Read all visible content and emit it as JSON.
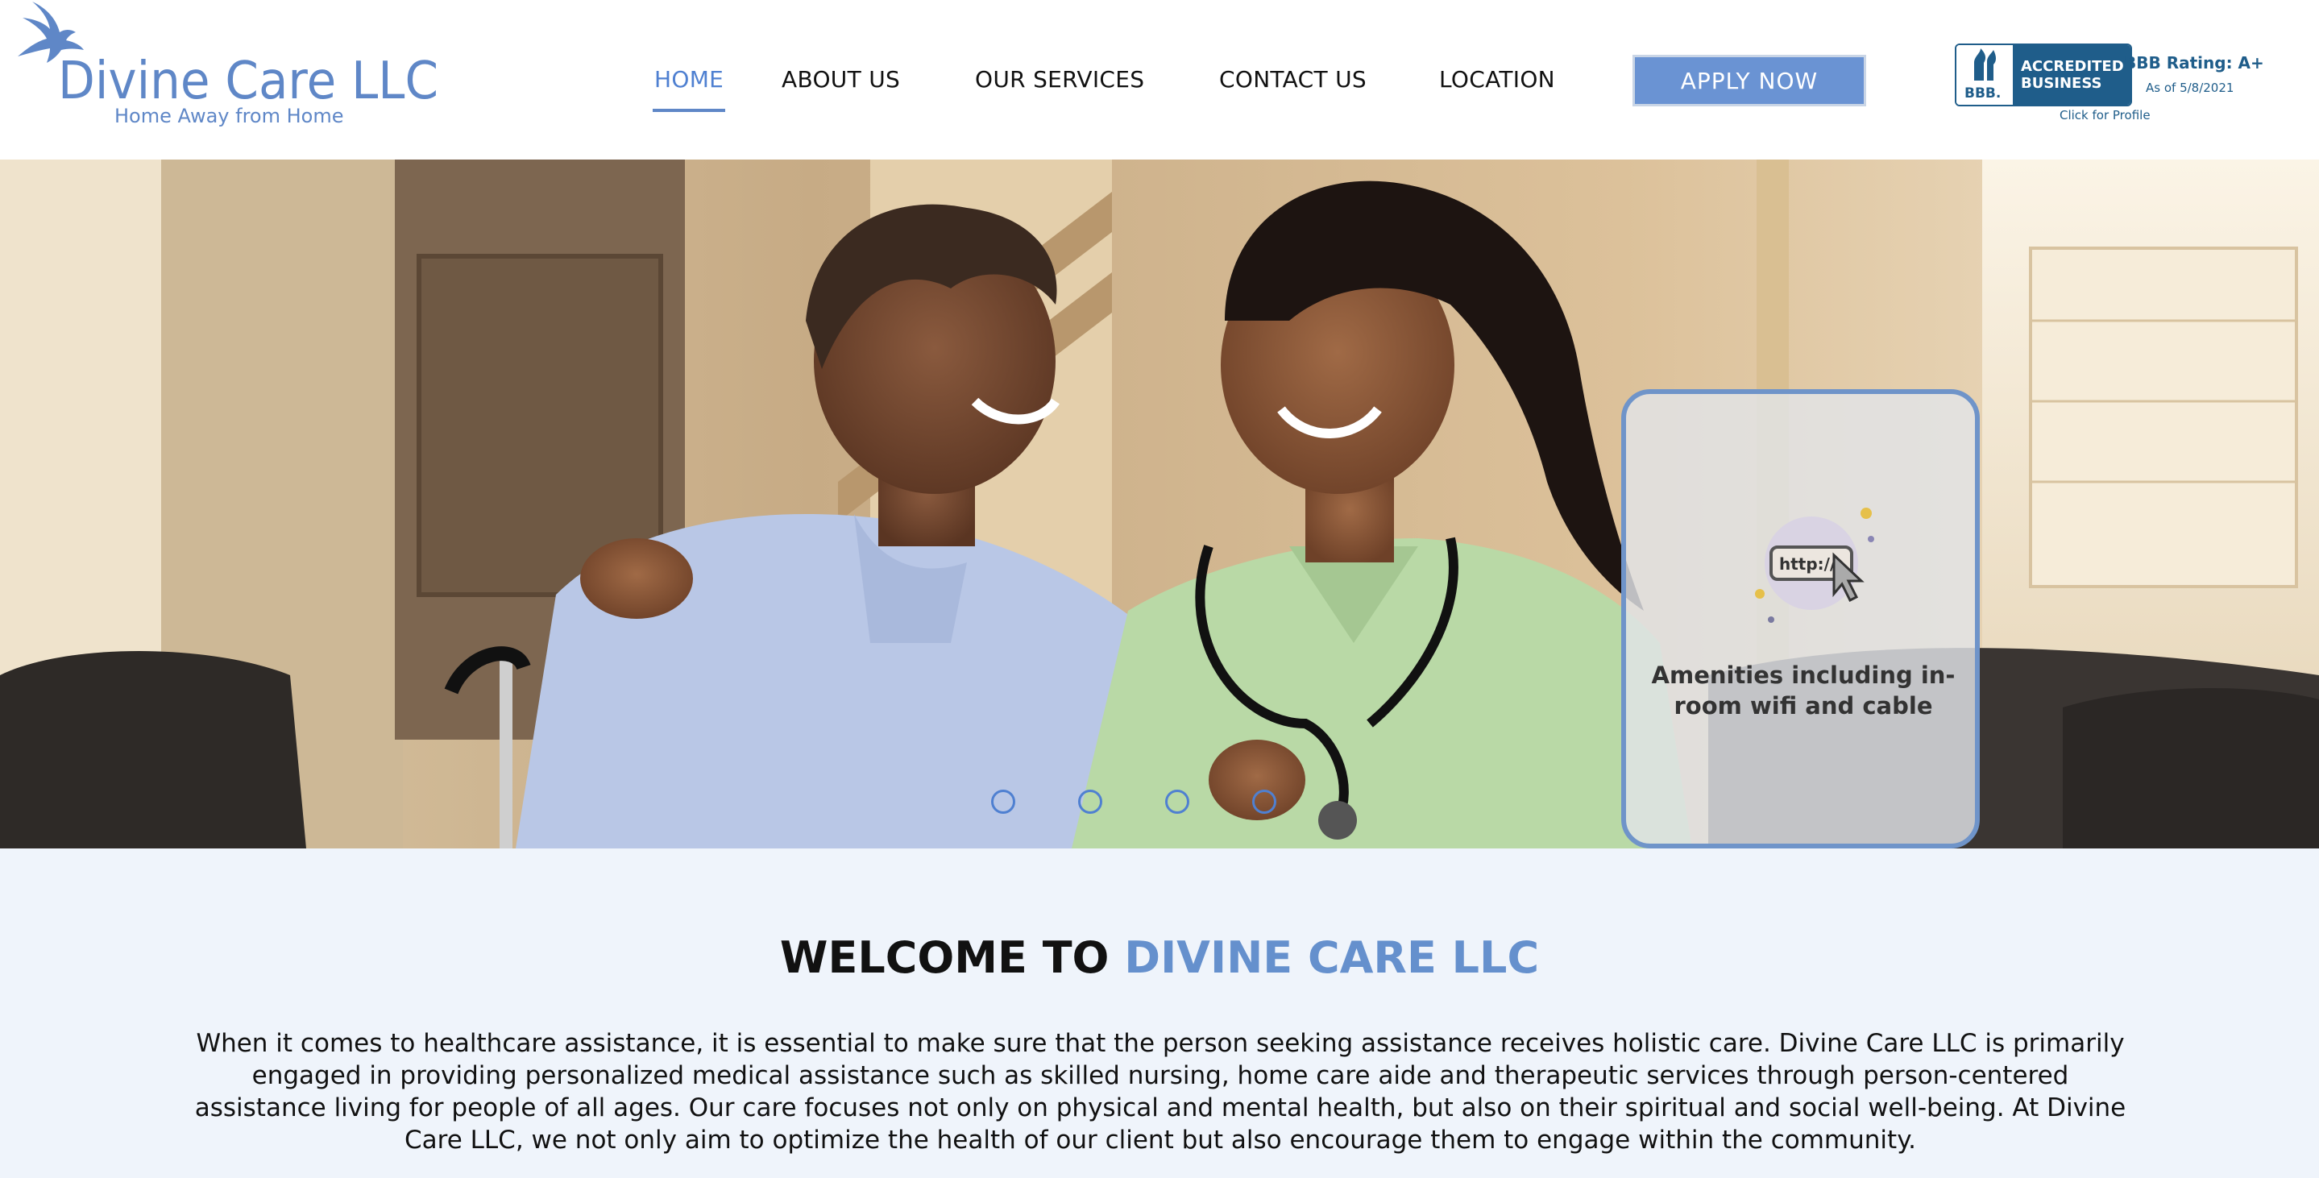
{
  "brand": {
    "name": "Divine Care LLC",
    "tagline": "Home Away from Home"
  },
  "nav": {
    "items": [
      {
        "label": "HOME",
        "active": true
      },
      {
        "label": "ABOUT US",
        "active": false
      },
      {
        "label": "OUR SERVICES",
        "active": false
      },
      {
        "label": "CONTACT US",
        "active": false
      },
      {
        "label": "LOCATION",
        "active": false
      }
    ],
    "apply_label": "APPLY NOW"
  },
  "bbb": {
    "seal": "BBB.",
    "badge_line1": "ACCREDITED",
    "badge_line2": "BUSINESS",
    "rating": "BBB Rating: A+",
    "as_of": "As of 5/8/2021",
    "cta": "Click for Profile"
  },
  "hero": {
    "card_icon_text": "http://",
    "card_text": "Amenities including in-room wifi and cable",
    "slides_count": 4
  },
  "welcome": {
    "heading_prefix": "WELCOME TO ",
    "heading_brand": "DIVINE CARE LLC",
    "body": "When it comes to healthcare assistance, it is essential to make sure that the person seeking assistance receives holistic care. Divine Care LLC is primarily engaged in providing personalized medical assistance such as skilled nursing, home care aide and therapeutic services through person-centered assistance living for people of all ages. Our care focuses not only on physical and mental health, but also on their spiritual and social well-being. At Divine Care LLC, we not only aim to optimize the health of our client but also encourage them to engage within the community."
  },
  "colors": {
    "accent": "#5f87c7",
    "nav_active": "#4f80d1",
    "apply_button": "#6a93d3",
    "bbb_blue": "#1f5d8a",
    "welcome_bg": "#eff4fb"
  }
}
